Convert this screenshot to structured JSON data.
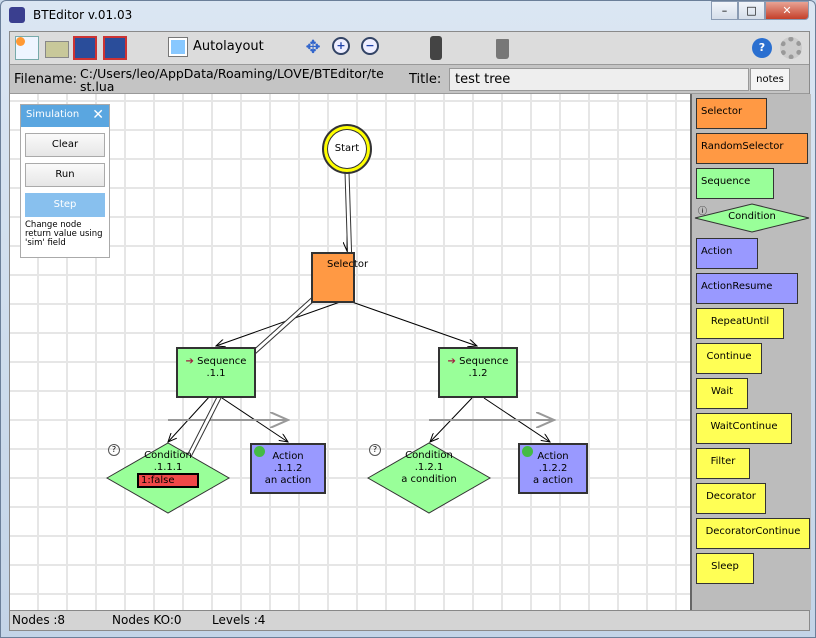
{
  "window": {
    "title": "BTEditor v.01.03",
    "minimize": "–",
    "maximize": "□",
    "close": "✕"
  },
  "toolbar": {
    "autolayout_label": "Autolayout",
    "icons": [
      "new-file-icon",
      "open-folder-icon",
      "save-icon",
      "save-as-icon",
      "move-icon",
      "zoom-in-icon",
      "zoom-out-icon",
      "traffic-light-icon",
      "trash-icon",
      "help-icon",
      "settings-gear-icon"
    ]
  },
  "filebar": {
    "filename_label": "Filename:",
    "filename_value": "C:/Users/leo/AppData/Roaming/LOVE/BTEditor/test.lua",
    "title_label": "Title:",
    "title_value": "test tree",
    "notes_label": "notes"
  },
  "simulation": {
    "title": "Simulation",
    "clear": "Clear",
    "run": "Run",
    "step": "Step",
    "hint": "Change node return value using 'sim' field"
  },
  "tree": {
    "start": "Start",
    "selector": "Selector",
    "seq1": {
      "name": "Sequence",
      "id": ".1.1"
    },
    "seq2": {
      "name": "Sequence",
      "id": ".1.2"
    },
    "cond1": {
      "name": "Condition",
      "id": ".1.1.1",
      "result": "1:false"
    },
    "act1": {
      "name": "Action",
      "id": ".1.1.2",
      "desc": "an action"
    },
    "cond2": {
      "name": "Condition",
      "id": ".1.2.1",
      "desc": "a condition"
    },
    "act2": {
      "name": "Action",
      "id": ".1.2.2",
      "desc": "a action"
    }
  },
  "palette": [
    {
      "label": "Selector",
      "color": "#ff9944"
    },
    {
      "label": "RandomSelector",
      "color": "#ff9944"
    },
    {
      "label": "Sequence",
      "color": "#99ff99"
    },
    {
      "label": "Condition",
      "color": "#99ff99"
    },
    {
      "label": "Action",
      "color": "#9999ff"
    },
    {
      "label": "ActionResume",
      "color": "#9999ff"
    },
    {
      "label": "RepeatUntil",
      "color": "#ffff55"
    },
    {
      "label": "Continue",
      "color": "#ffff55"
    },
    {
      "label": "Wait",
      "color": "#ffff55"
    },
    {
      "label": "WaitContinue",
      "color": "#ffff55"
    },
    {
      "label": "Filter",
      "color": "#ffff55"
    },
    {
      "label": "Decorator",
      "color": "#ffff55"
    },
    {
      "label": "DecoratorContinue",
      "color": "#ffff55"
    },
    {
      "label": "Sleep",
      "color": "#ffff55"
    }
  ],
  "status": {
    "nodes": "Nodes :8",
    "nodes_ko": "Nodes KO:0",
    "levels": "Levels :4"
  }
}
